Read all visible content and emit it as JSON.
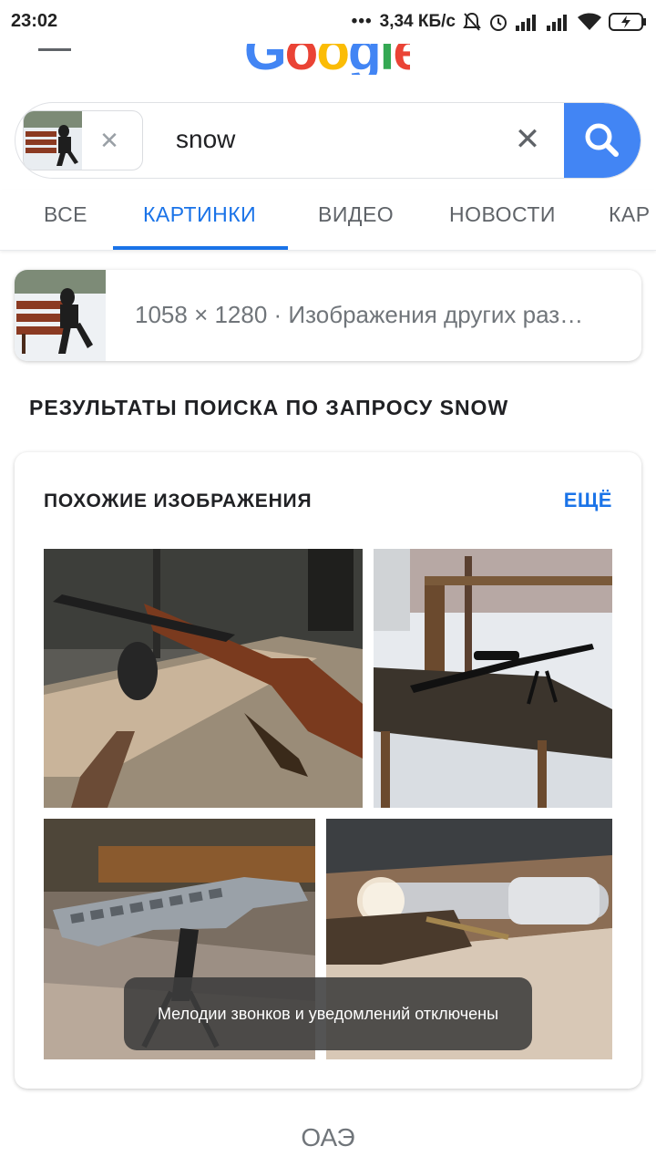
{
  "status": {
    "time": "23:02",
    "speed": "3,34 КБ/с"
  },
  "search": {
    "query": "snow"
  },
  "tabs": [
    {
      "label": "ВСЕ"
    },
    {
      "label": "КАРТИНКИ"
    },
    {
      "label": "ВИДЕО"
    },
    {
      "label": "НОВОСТИ"
    },
    {
      "label": "КАР"
    }
  ],
  "image_info": {
    "text": "1058 × 1280 · Изображения других раз…"
  },
  "results": {
    "heading": "РЕЗУЛЬТАТЫ ПОИСКА ПО ЗАПРОСУ SNOW"
  },
  "similar": {
    "title": "ПОХОЖИЕ ИЗОБРАЖЕНИЯ",
    "more_label": "ЕЩЁ"
  },
  "toast": {
    "text": "Мелодии звонков и уведомлений отключены"
  },
  "footer": {
    "text": "ОАЭ"
  },
  "colors": {
    "accent": "#1a73e8",
    "search_button": "#4285f4"
  }
}
